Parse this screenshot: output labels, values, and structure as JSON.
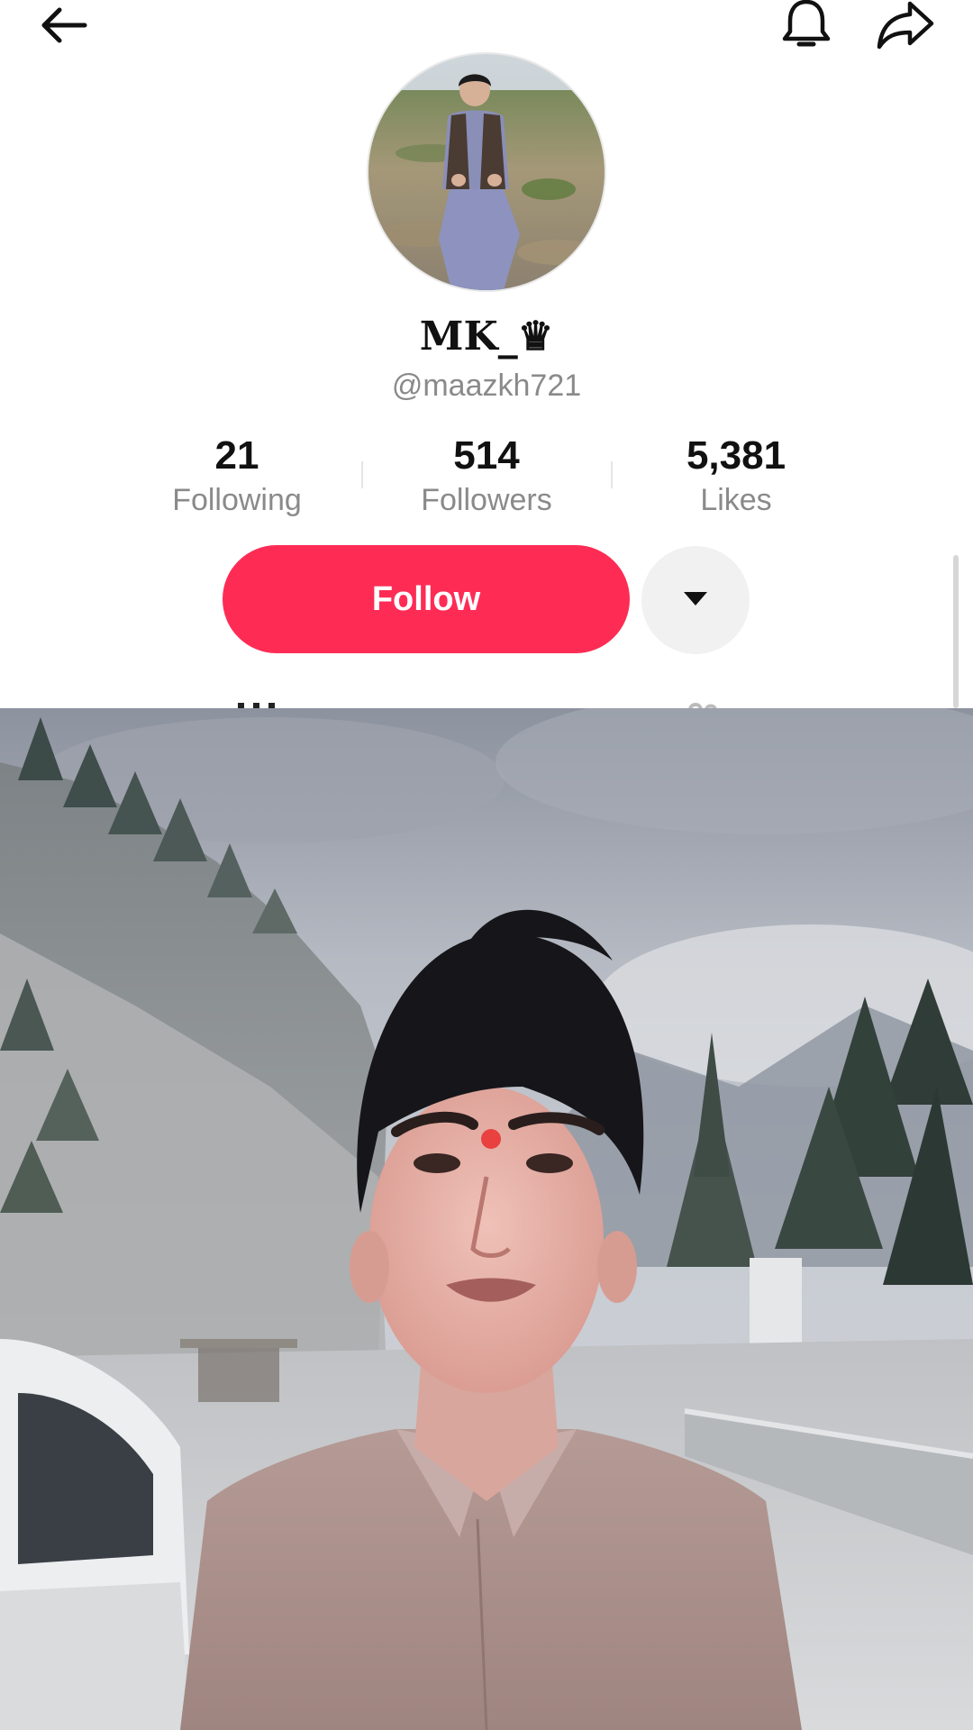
{
  "profile": {
    "display_name": "MK_♛",
    "handle": "@maazkh721"
  },
  "stats": {
    "following": {
      "value": "21",
      "label": "Following"
    },
    "followers": {
      "value": "514",
      "label": "Followers"
    },
    "likes": {
      "value": "5,381",
      "label": "Likes"
    }
  },
  "actions": {
    "follow_label": "Follow"
  },
  "icons": {
    "back": "arrow-left-icon",
    "notifications": "bell-icon",
    "share": "share-arrow-icon",
    "more": "caret-down-icon"
  },
  "colors": {
    "follow_button": "#fe2c55",
    "more_button_bg": "#f1f1f2",
    "secondary_text": "#8a8a8a"
  }
}
